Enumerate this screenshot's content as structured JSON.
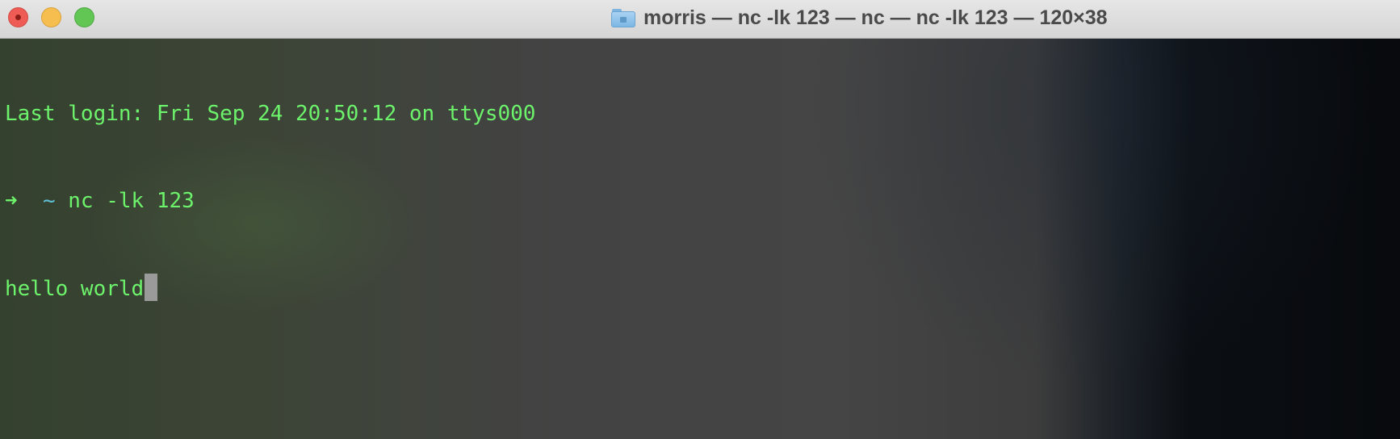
{
  "window": {
    "title": "morris — nc -lk 123 — nc — nc -lk 123 — 120×38",
    "folder_icon": "folder-icon",
    "controls": {
      "close_color": "#ee5c55",
      "minimize_color": "#f6be4f",
      "zoom_color": "#62c655"
    }
  },
  "terminal": {
    "last_login": "Last login: Fri Sep 24 20:50:12 on ttys000",
    "prompt_arrow": "➜",
    "prompt_dir": "~",
    "command": "nc -lk 123",
    "output": "hello world",
    "text_color": "#6df26b",
    "dir_color": "#5fc0d8"
  }
}
